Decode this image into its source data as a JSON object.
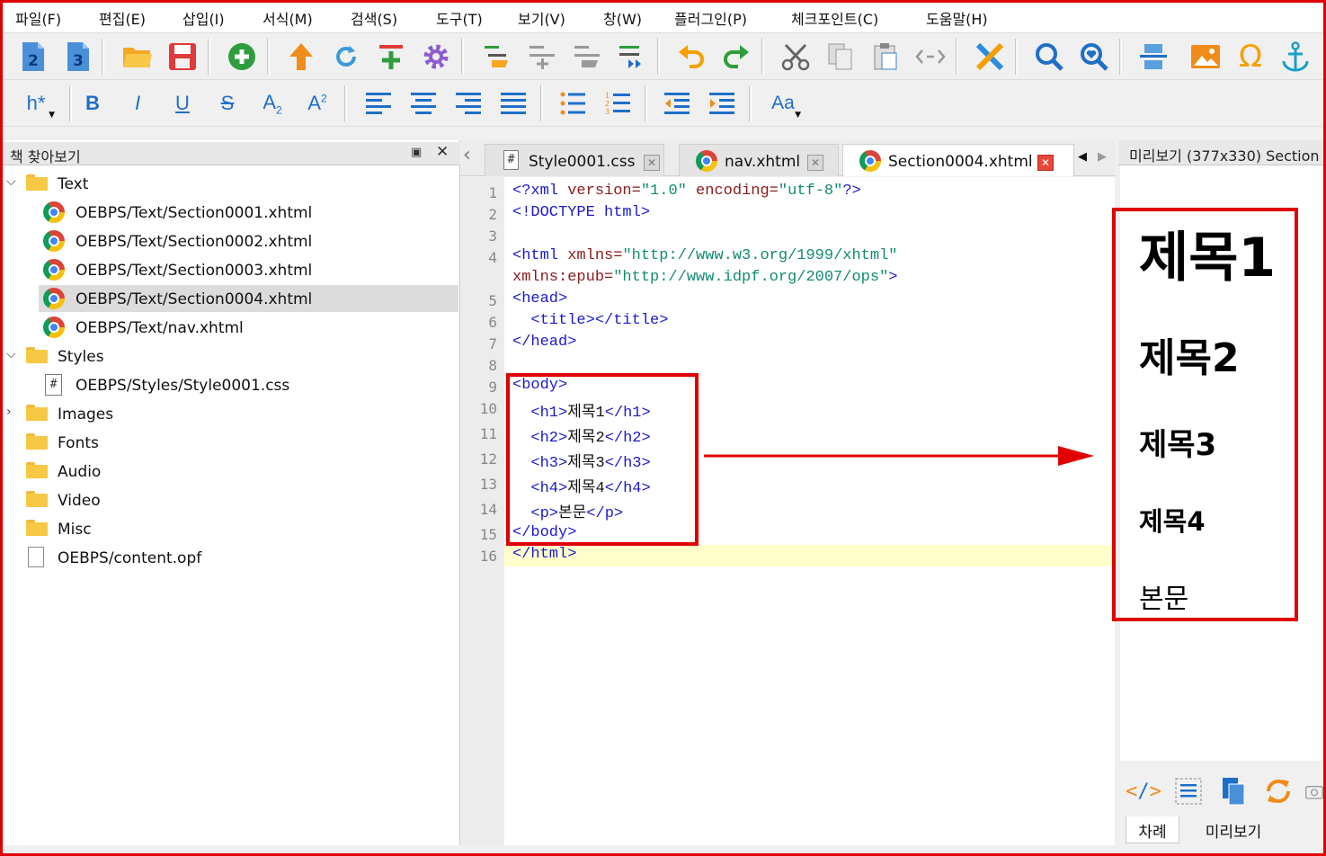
{
  "menu": [
    "파일(F)",
    "편집(E)",
    "삽입(I)",
    "서식(M)",
    "검색(S)",
    "도구(T)",
    "보기(V)",
    "창(W)",
    "플러그인(P)",
    "체크포인트(C)",
    "도움말(H)"
  ],
  "toolbar": {
    "epub2": "2",
    "epub3": "3",
    "heading_btn": "h*",
    "bold": "B",
    "italic": "I",
    "underline": "U",
    "strike": "S",
    "subscript": "A",
    "subscript_mark": "2",
    "superscript": "A",
    "superscript_mark": "2",
    "case": "Aa"
  },
  "browser": {
    "title": "책 찾아보기",
    "tree": [
      {
        "label": "Text",
        "kind": "folder",
        "expanded": true
      },
      {
        "label": "OEBPS/Text/Section0001.xhtml",
        "kind": "xhtml"
      },
      {
        "label": "OEBPS/Text/Section0002.xhtml",
        "kind": "xhtml"
      },
      {
        "label": "OEBPS/Text/Section0003.xhtml",
        "kind": "xhtml"
      },
      {
        "label": "OEBPS/Text/Section0004.xhtml",
        "kind": "xhtml",
        "selected": true
      },
      {
        "label": "OEBPS/Text/nav.xhtml",
        "kind": "xhtml"
      },
      {
        "label": "Styles",
        "kind": "folder",
        "expanded": true
      },
      {
        "label": "OEBPS/Styles/Style0001.css",
        "kind": "css"
      },
      {
        "label": "Images",
        "kind": "folder",
        "expanded": false
      },
      {
        "label": "Fonts",
        "kind": "folder"
      },
      {
        "label": "Audio",
        "kind": "folder"
      },
      {
        "label": "Video",
        "kind": "folder"
      },
      {
        "label": "Misc",
        "kind": "folder"
      },
      {
        "label": "OEBPS/content.opf",
        "kind": "file"
      }
    ]
  },
  "tabs": [
    {
      "label": "Style0001.css",
      "active": false
    },
    {
      "label": "nav.xhtml",
      "active": false
    },
    {
      "label": "Section0004.xhtml",
      "active": true
    }
  ],
  "code": {
    "line_numbers": [
      "1",
      "2",
      "3",
      "4",
      "5",
      "6",
      "7",
      "8",
      "9",
      "10",
      "11",
      "12",
      "13",
      "14",
      "15",
      "16"
    ],
    "l1_a": "<?xml ",
    "l1_b": "version=",
    "l1_c": "\"1.0\"",
    "l1_d": " encoding=",
    "l1_e": "\"utf-8\"",
    "l1_f": "?>",
    "l2": "<!DOCTYPE html>",
    "l4_a": "<html ",
    "l4_b": "xmlns=",
    "l4_c": "\"http://www.w3.org/1999/xhtml\"",
    "l4w_a": "xmlns:epub=",
    "l4w_b": "\"http://www.idpf.org/2007/ops\"",
    "l4w_c": ">",
    "l5": "<head>",
    "l6": "  <title></title>",
    "l7": "</head>",
    "l9": "<body>",
    "l10_a": "  <h1>",
    "l10_b": "제목1",
    "l10_c": "</h1>",
    "l11_a": "  <h2>",
    "l11_b": "제목2",
    "l11_c": "</h2>",
    "l12_a": "  <h3>",
    "l12_b": "제목3",
    "l12_c": "</h3>",
    "l13_a": "  <h4>",
    "l13_b": "제목4",
    "l13_c": "</h4>",
    "l14_a": "  <p>",
    "l14_b": "본문",
    "l14_c": "</p>",
    "l15": "</body>",
    "l16": "</html>"
  },
  "preview": {
    "title": "미리보기 (377x330) Section",
    "h1": "제목1",
    "h2": "제목2",
    "h3": "제목3",
    "h4": "제목4",
    "p": "본문"
  },
  "bottom_tabs": [
    "차례",
    "미리보기"
  ],
  "colors": {
    "annotation": "#e00000",
    "tag": "#1a1acc",
    "attribute": "#8b1a1a",
    "value": "#138a72",
    "current_line": "#ffffcc"
  }
}
